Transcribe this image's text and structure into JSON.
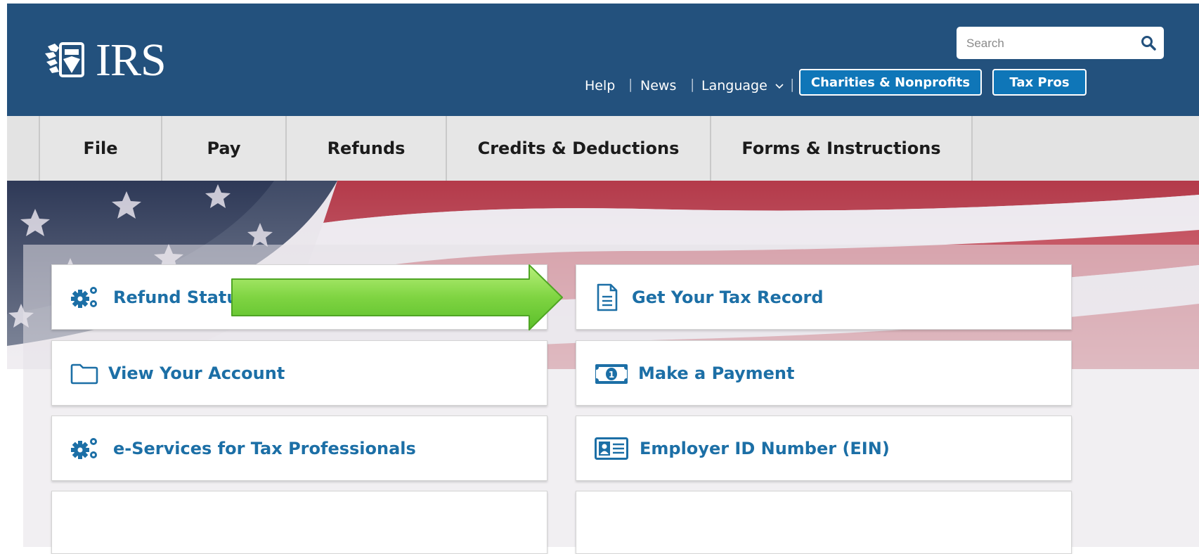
{
  "header": {
    "logo_text": "IRS",
    "search": {
      "placeholder": "Search"
    },
    "utility_links": [
      "Help",
      "News",
      "Language"
    ],
    "buttons": {
      "charities": "Charities & Nonprofits",
      "tax_pros": "Tax Pros"
    }
  },
  "nav": {
    "items": [
      "File",
      "Pay",
      "Refunds",
      "Credits & Deductions",
      "Forms & Instructions"
    ]
  },
  "cards": {
    "left": [
      "Refund Status",
      "View Your Account",
      "e-Services for Tax Professionals"
    ],
    "right": [
      "Get Your Tax Record",
      "Make a Payment",
      "Employer ID Number (EIN)"
    ]
  },
  "icons": {
    "search": "search-icon",
    "refund_status": "gears-icon",
    "view_account": "folder-icon",
    "e_services": "gears-icon",
    "tax_record": "document-icon",
    "payment": "money-icon",
    "ein": "id-card-icon",
    "language_caret": "chevron-down-icon"
  },
  "colors": {
    "header_bg": "#23517d",
    "nav_bg": "#e3e3e3",
    "card_link": "#1c6fa6",
    "button_bg": "#0f76b8",
    "arrow": "#7fd442"
  }
}
